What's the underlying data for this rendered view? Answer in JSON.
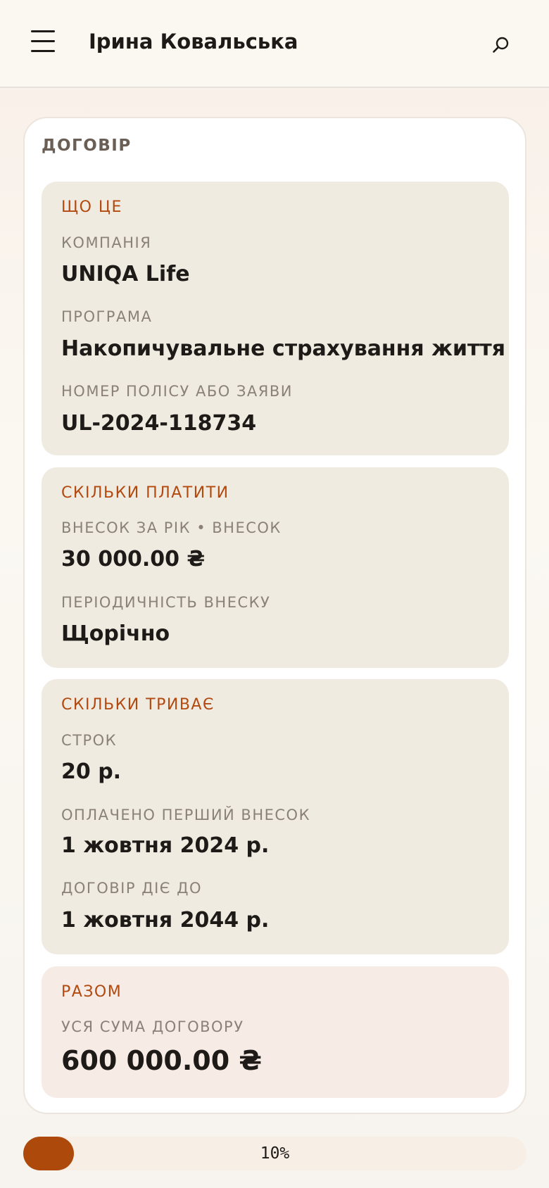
{
  "header": {
    "title": "Ірина Ковальська",
    "menu_icon": "hamburger-menu-icon",
    "search_icon": "search-icon"
  },
  "card": {
    "title": "ДОГОВІР",
    "sections": [
      {
        "title": "ЩО ЦЕ",
        "fields": [
          {
            "label": "КОМПАНІЯ",
            "value": "UNIQA Life"
          },
          {
            "label": "ПРОГРАМА",
            "value": "Накопичувальне страхування життя"
          },
          {
            "label": "НОМЕР ПОЛІСУ АБО ЗАЯВИ",
            "value": "UL-2024-118734"
          }
        ]
      },
      {
        "title": "СКІЛЬКИ ПЛАТИТИ",
        "fields": [
          {
            "label": "ВНЕСОК ЗА РІК • ВНЕСОК",
            "value": "30 000.00 ₴"
          },
          {
            "label": "ПЕРІОДИЧНІСТЬ ВНЕСКУ",
            "value": "Щорічно"
          }
        ]
      },
      {
        "title": "СКІЛЬКИ ТРИВАЄ",
        "fields": [
          {
            "label": "СТРОК",
            "value": "20 р."
          },
          {
            "label": "ОПЛАЧЕНО ПЕРШИЙ ВНЕСОК",
            "value": "1 жовтня 2024 р."
          },
          {
            "label": "ДОГОВІР ДІЄ ДО",
            "value": "1 жовтня 2044 р."
          }
        ]
      },
      {
        "title": "РАЗОМ",
        "fields": [
          {
            "label": "УСЯ СУМА ДОГОВОРУ",
            "value": "600 000.00 ₴"
          }
        ]
      }
    ]
  },
  "progress": {
    "text": "10%",
    "value": 0.1
  },
  "colors": {
    "accent": "#ad4a0b",
    "section_bg": "#f0ebe1",
    "total_bg": "#f6ebe5",
    "section_title": "#b24a10"
  }
}
